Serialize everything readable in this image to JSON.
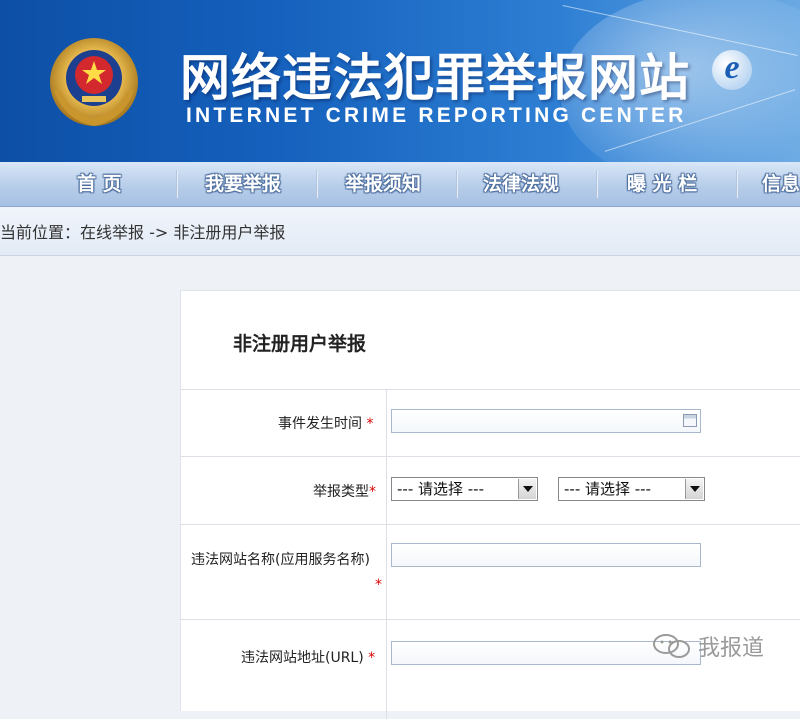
{
  "site": {
    "title_cn": "网络违法犯罪举报网站",
    "title_en": "INTERNET CRIME REPORTING CENTER"
  },
  "nav": {
    "items": [
      "首 页",
      "我要举报",
      "举报须知",
      "法律法规",
      "曝 光 栏",
      "信息"
    ]
  },
  "breadcrumb": {
    "text": "当前位置：在线举报 -> 非注册用户举报"
  },
  "form": {
    "title": "非注册用户举报",
    "fields": {
      "event_time_label": "事件发生时间",
      "report_type_label": "举报类型",
      "site_name_label": "违法网站名称(应用服务名称)",
      "site_url_label": "违法网站地址(URL)"
    },
    "required_mark": "*",
    "report_type_select_1": "--- 请选择 ---",
    "report_type_select_2": "--- 请选择 ---"
  },
  "watermark": {
    "text": "我报道"
  },
  "colors": {
    "banner_blue": "#1561bd",
    "required_red": "#d80000"
  }
}
